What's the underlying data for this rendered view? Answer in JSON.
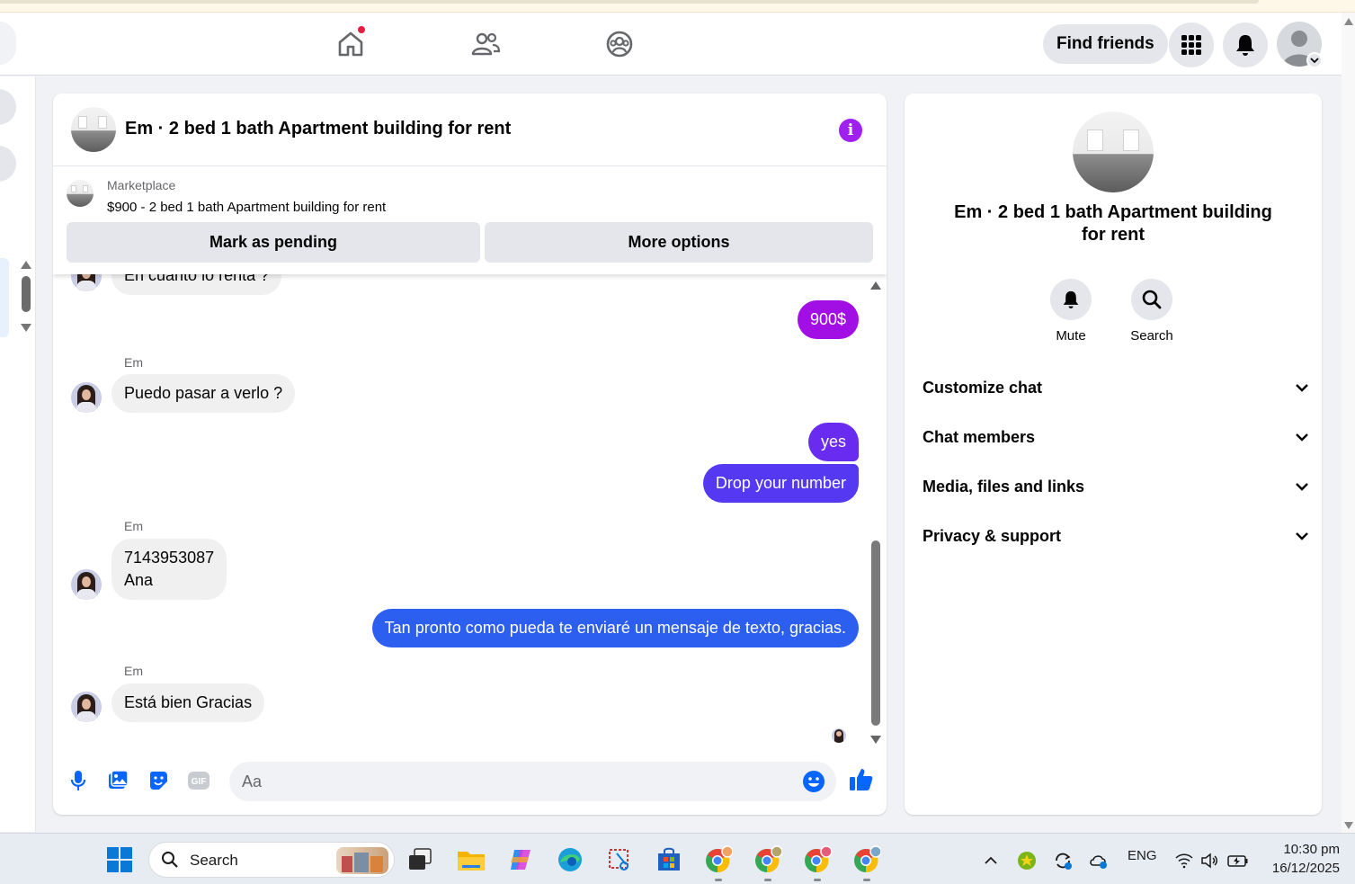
{
  "nav": {
    "find_friends": "Find friends"
  },
  "chat": {
    "title": "Em · 2 bed 1 bath Apartment building for rent",
    "marketplace": {
      "label": "Marketplace",
      "item": "$900 - 2 bed 1 bath Apartment building for rent",
      "pending_button": "Mark as pending",
      "more_button": "More options"
    },
    "partial_message": "En cuanto lo renta ?",
    "messages": [
      {
        "from": "me",
        "text": "900$"
      },
      {
        "from": "Em",
        "sender": "Em",
        "text": "Puedo pasar a verlo ?"
      },
      {
        "from": "me",
        "text": "yes"
      },
      {
        "from": "me",
        "text": "Drop your number"
      },
      {
        "from": "Em",
        "sender": "Em",
        "lines": [
          "7143953087",
          "Ana"
        ]
      },
      {
        "from": "me",
        "text": "Tan pronto como pueda te enviaré un mensaje de texto, gracias."
      },
      {
        "from": "Em",
        "sender": "Em",
        "text": "Está bien Gracias"
      }
    ],
    "composer": {
      "placeholder": "Aa"
    }
  },
  "info_panel": {
    "name_line1": "Em · 2 bed 1 bath Apartment building",
    "name_line2": "for rent",
    "actions": [
      {
        "label": "Mute",
        "icon": "bell-icon"
      },
      {
        "label": "Search",
        "icon": "search-icon"
      }
    ],
    "sections": [
      "Customize chat",
      "Chat members",
      "Media, files and links",
      "Privacy & support"
    ]
  },
  "taskbar": {
    "search": "Search",
    "language": "ENG",
    "time": "10:30 pm",
    "date": "16/12/2025"
  },
  "colors": {
    "bubble_purple": "#a20fe5",
    "bubble_violet": "#6a2bf0",
    "bubble_indigo": "#5438f2",
    "bubble_blue": "#2c5ff0",
    "incoming": "#f0f0f0",
    "accent_blue": "#0866ff",
    "info_purple": "#a020f0"
  }
}
